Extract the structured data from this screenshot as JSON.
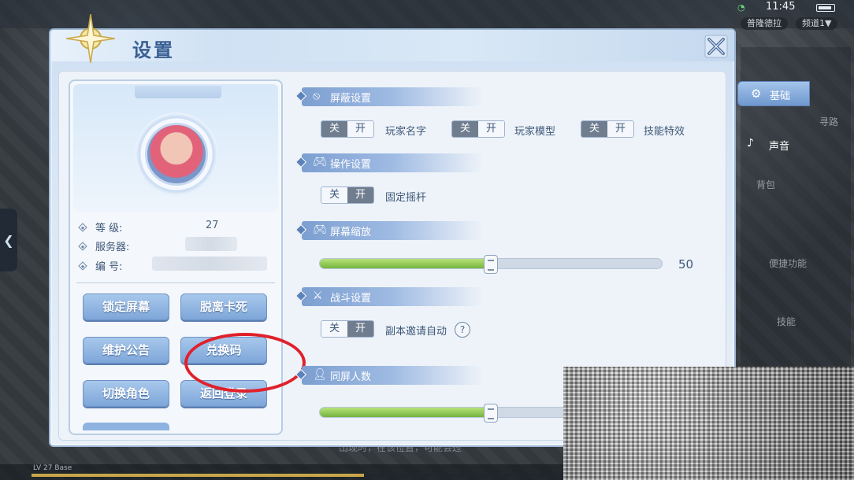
{
  "status": {
    "time": "11:45"
  },
  "top_pills": [
    "普隆德拉",
    "频道1▼"
  ],
  "dialog": {
    "title": "设置"
  },
  "profile": {
    "level_label": "等  级:",
    "level_value": "27",
    "server_label": "服务器:",
    "server_value": "",
    "id_label": "编  号:",
    "id_value": ""
  },
  "profile_buttons": {
    "lock_screen": "锁定屏幕",
    "unstuck": "脱离卡死",
    "maintenance": "维护公告",
    "redeem": "兑换码",
    "switch_role": "切换角色",
    "back_login": "返回登录"
  },
  "sections": {
    "block": {
      "label": "屏蔽设置",
      "icon": "block-icon"
    },
    "control": {
      "label": "操作设置",
      "icon": "gamepad-icon"
    },
    "zoom": {
      "label": "屏幕缩放",
      "icon": "gamepad-icon"
    },
    "combat": {
      "label": "战斗设置",
      "icon": "sword-icon"
    },
    "same_screen": {
      "label": "同屏人数",
      "icon": "person-icon"
    }
  },
  "toggles": {
    "off_label": "关",
    "on_label": "开",
    "player_name": "玩家名字",
    "player_model": "玩家模型",
    "skill_fx": "技能特效",
    "fixed_joystick": "固定摇杆",
    "dungeon_invite": "副本邀请自动"
  },
  "sliders": {
    "zoom": {
      "value": 50,
      "fill": 0.5,
      "display": "50"
    },
    "same_screen": {
      "fill": 0.5
    }
  },
  "side_tabs": {
    "basic": "基础",
    "sound": "声音"
  },
  "background": {
    "level_bar": "LV 27 Base",
    "bottom_tip": "出现时，在该位置，可能会过",
    "ghost_labels": [
      "便捷功能",
      "技能",
      "背包",
      "寻路"
    ]
  },
  "colors": {
    "accent": "#7ea6d9",
    "slider_fill": "#75b43e",
    "circle": "#e0212b",
    "title": "#3a5f93"
  }
}
